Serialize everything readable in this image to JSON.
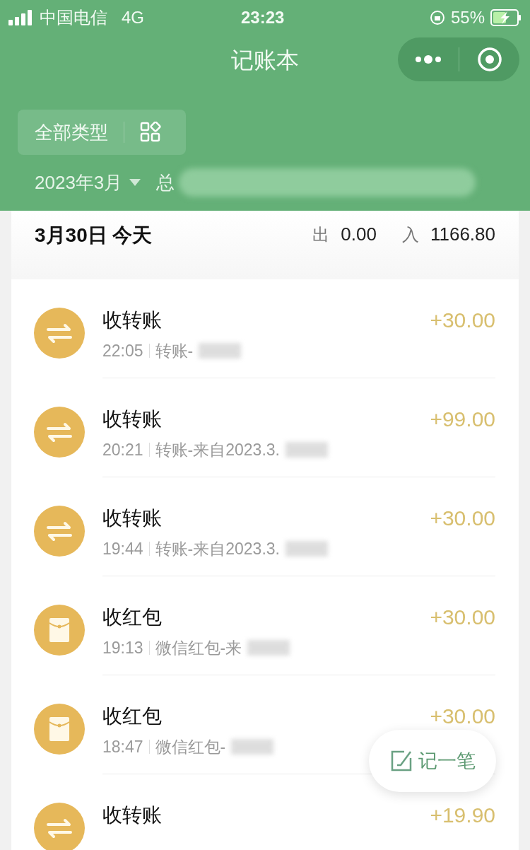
{
  "status_bar": {
    "carrier": "中国电信",
    "network": "4G",
    "time": "23:23",
    "battery": "55%"
  },
  "nav": {
    "title": "记账本"
  },
  "filter": {
    "label": "全部类型"
  },
  "month": {
    "label": "2023年3月",
    "total_label": "总"
  },
  "day": {
    "date": "3月30日 今天",
    "out_label": "出",
    "out": "0.00",
    "in_label": "入",
    "in": "1166.80"
  },
  "records": [
    {
      "kind": "transfer",
      "title": "收转账",
      "time": "22:05",
      "note": "转账-",
      "amount": "+30.00"
    },
    {
      "kind": "transfer",
      "title": "收转账",
      "time": "20:21",
      "note": "转账-来自2023.3.",
      "amount": "+99.00"
    },
    {
      "kind": "transfer",
      "title": "收转账",
      "time": "19:44",
      "note": "转账-来自2023.3.",
      "amount": "+30.00"
    },
    {
      "kind": "red_packet",
      "title": "收红包",
      "time": "19:13",
      "note": "微信红包-来",
      "amount": "+30.00"
    },
    {
      "kind": "red_packet",
      "title": "收红包",
      "time": "18:47",
      "note": "微信红包-",
      "amount": "+30.00"
    },
    {
      "kind": "transfer",
      "title": "收转账",
      "amount": "+19.90"
    }
  ],
  "add_button": {
    "label": "记一笔"
  }
}
